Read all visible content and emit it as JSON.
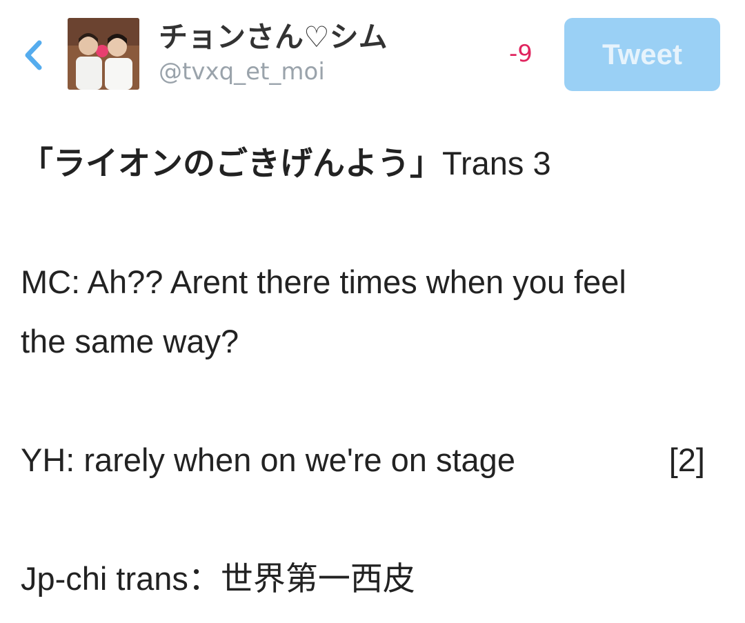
{
  "header": {
    "back_icon": "chevron-left-icon",
    "display_name": "チョンさん♡シム",
    "handle": "@tvxq_et_moi",
    "char_count": "-9",
    "tweet_label": "Tweet",
    "colors": {
      "accent": "#55acee",
      "button_bg": "#9ad0f5",
      "counter": "#e0245e"
    }
  },
  "compose": {
    "title_jp": "「ライオンのごきげんよう」",
    "title_trans": "Trans 3",
    "mc_line_1": "MC: Ah?? Arent there times when you feel",
    "mc_line_2": "the same way?",
    "yh_line": "YH: rarely when on we're on stage",
    "yh_ref": "[2]",
    "jp_label": "Jp-chi trans：",
    "jp_text": "世界第一西皮"
  }
}
